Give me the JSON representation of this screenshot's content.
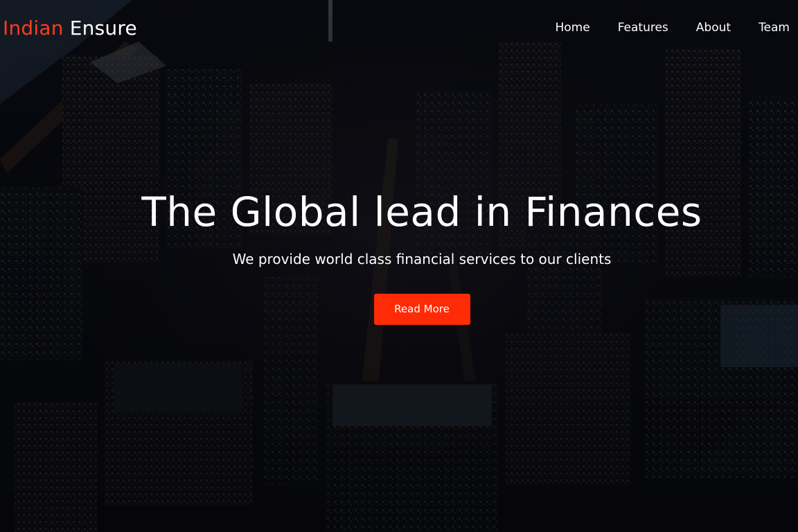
{
  "brand": {
    "first": "Indian",
    "second": "Ensure",
    "first_color": "#ff3b1f",
    "second_color": "#ffffff"
  },
  "nav": {
    "items": [
      {
        "label": "Home"
      },
      {
        "label": "Features"
      },
      {
        "label": "About"
      },
      {
        "label": "Team"
      }
    ]
  },
  "hero": {
    "title": "The Global lead in Finances",
    "subtitle": "We provide world class financial services to our clients",
    "button_label": "Read More",
    "button_color": "#ff2a06",
    "background": "night-city-aerial-photo"
  }
}
